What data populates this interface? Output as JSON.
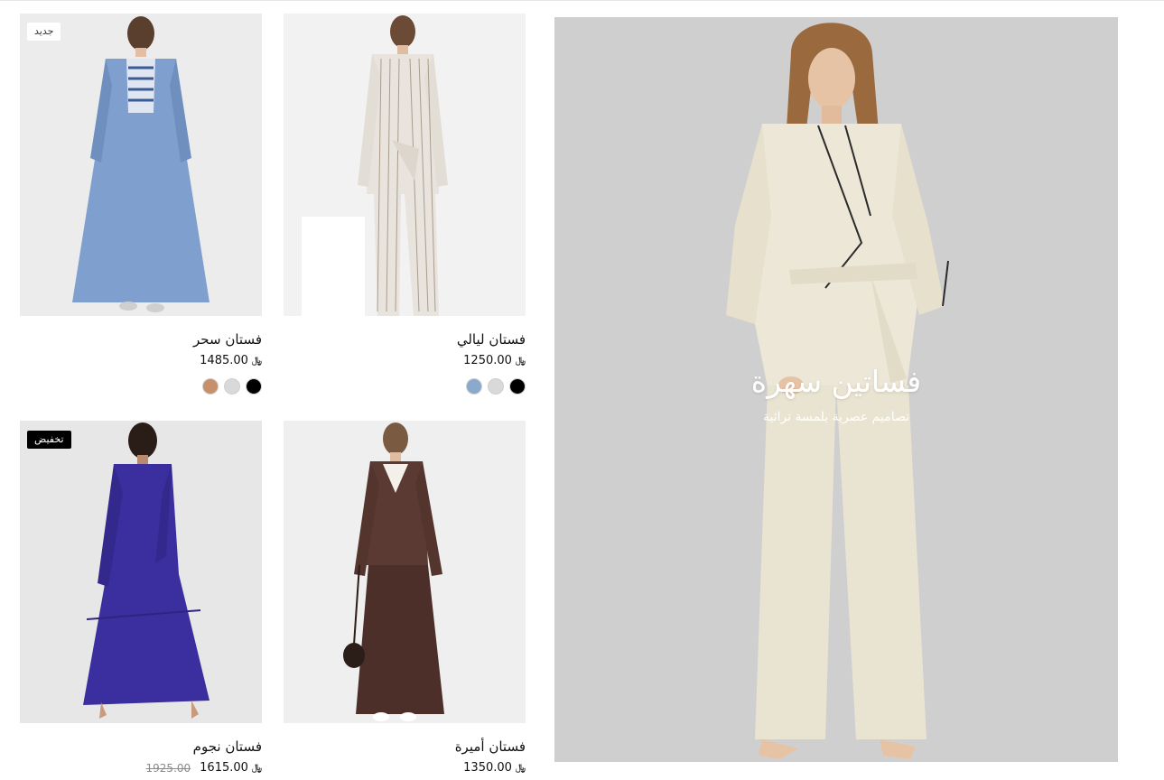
{
  "products": [
    {
      "name": "فستان سحر",
      "price": "1485.00",
      "currency": "﷼",
      "badge": "جديد",
      "swatches": [
        "#c7906a",
        "#d9d9d9",
        "#000000"
      ],
      "photo_bg": "#ececec",
      "garment_color": "#7f9fcf"
    },
    {
      "name": "فستان ليالي",
      "price": "1250.00",
      "currency": "﷼",
      "badge": "",
      "swatches": [
        "#8aa9cc",
        "#d9d9d9",
        "#000000"
      ],
      "photo_bg": "#f2f2f2",
      "garment_color": "#e8e3dc"
    },
    {
      "name": "فستان نجوم",
      "price": "1615.00",
      "old_price": "1925.00",
      "currency": "﷼",
      "badge": "تخفيض",
      "swatches": [],
      "photo_bg": "#e7e7e7",
      "garment_color": "#3b2e9e"
    },
    {
      "name": "فستان أميرة",
      "price": "1350.00",
      "currency": "﷼",
      "badge": "",
      "swatches": [],
      "photo_bg": "#efefef",
      "garment_color": "#5a3a33"
    }
  ],
  "hero": {
    "title": "فساتين سهرة",
    "subtitle": "تصاميم عصرية بلمسة تراثية",
    "bg": "#cfcfcf",
    "garment_color": "#ece7d6",
    "piping_color": "#2b2b2b"
  }
}
